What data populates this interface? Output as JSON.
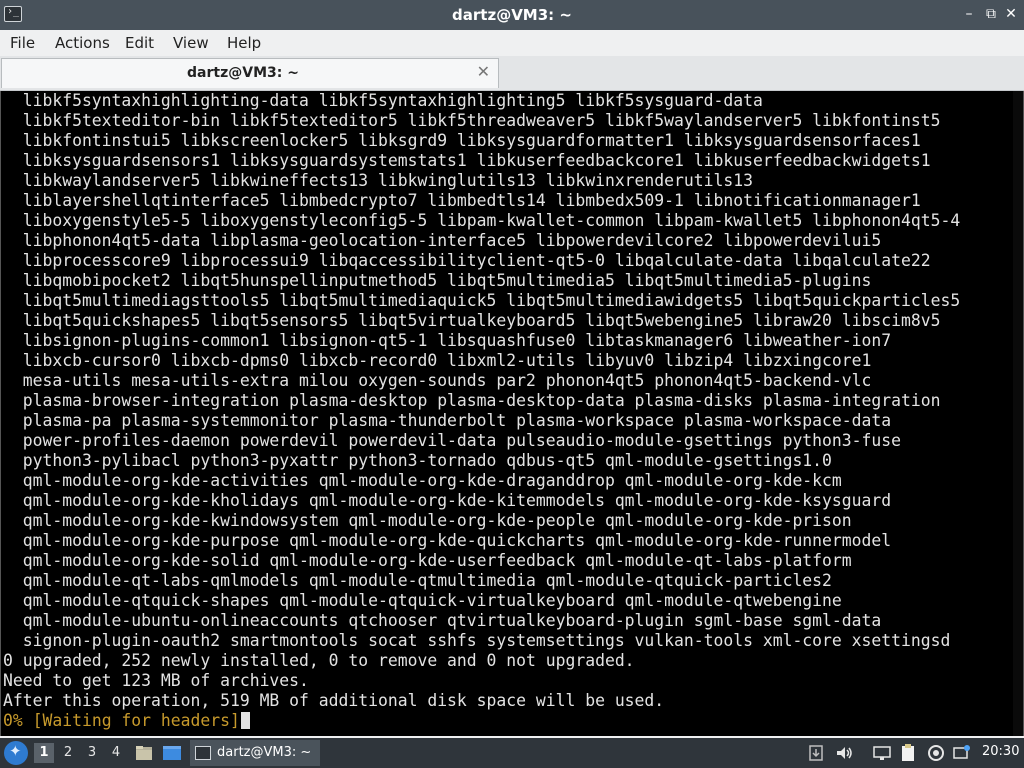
{
  "window": {
    "title": "dartz@VM3: ~",
    "controls": {
      "minimize": "–",
      "maximize": "⧉",
      "close": "✕"
    }
  },
  "menu": {
    "items": [
      "File",
      "Actions",
      "Edit",
      "View",
      "Help"
    ]
  },
  "tab": {
    "label": "dartz@VM3: ~",
    "close": "✕"
  },
  "terminal": {
    "lines": [
      "  libkf5syntaxhighlighting-data libkf5syntaxhighlighting5 libkf5sysguard-data",
      "  libkf5texteditor-bin libkf5texteditor5 libkf5threadweaver5 libkf5waylandserver5 libkfontinst5",
      "  libkfontinstui5 libkscreenlocker5 libksgrd9 libksysguardformatter1 libksysguardsensorfaces1",
      "  libksysguardsensors1 libksysguardsystemstats1 libkuserfeedbackcore1 libkuserfeedbackwidgets1",
      "  libkwaylandserver5 libkwineffects13 libkwinglutils13 libkwinxrenderutils13",
      "  liblayershellqtinterface5 libmbedcrypto7 libmbedtls14 libmbedx509-1 libnotificationmanager1",
      "  liboxygenstyle5-5 liboxygenstyleconfig5-5 libpam-kwallet-common libpam-kwallet5 libphonon4qt5-4",
      "  libphonon4qt5-data libplasma-geolocation-interface5 libpowerdevilcore2 libpowerdevilui5",
      "  libprocesscore9 libprocessui9 libqaccessibilityclient-qt5-0 libqalculate-data libqalculate22",
      "  libqmobipocket2 libqt5hunspellinputmethod5 libqt5multimedia5 libqt5multimedia5-plugins",
      "  libqt5multimediagsttools5 libqt5multimediaquick5 libqt5multimediawidgets5 libqt5quickparticles5",
      "  libqt5quickshapes5 libqt5sensors5 libqt5virtualkeyboard5 libqt5webengine5 libraw20 libscim8v5",
      "  libsignon-plugins-common1 libsignon-qt5-1 libsquashfuse0 libtaskmanager6 libweather-ion7",
      "  libxcb-cursor0 libxcb-dpms0 libxcb-record0 libxml2-utils libyuv0 libzip4 libzxingcore1",
      "  mesa-utils mesa-utils-extra milou oxygen-sounds par2 phonon4qt5 phonon4qt5-backend-vlc",
      "  plasma-browser-integration plasma-desktop plasma-desktop-data plasma-disks plasma-integration",
      "  plasma-pa plasma-systemmonitor plasma-thunderbolt plasma-workspace plasma-workspace-data",
      "  power-profiles-daemon powerdevil powerdevil-data pulseaudio-module-gsettings python3-fuse",
      "  python3-pylibacl python3-pyxattr python3-tornado qdbus-qt5 qml-module-gsettings1.0",
      "  qml-module-org-kde-activities qml-module-org-kde-draganddrop qml-module-org-kde-kcm",
      "  qml-module-org-kde-kholidays qml-module-org-kde-kitemmodels qml-module-org-kde-ksysguard",
      "  qml-module-org-kde-kwindowsystem qml-module-org-kde-people qml-module-org-kde-prison",
      "  qml-module-org-kde-purpose qml-module-org-kde-quickcharts qml-module-org-kde-runnermodel",
      "  qml-module-org-kde-solid qml-module-org-kde-userfeedback qml-module-qt-labs-platform",
      "  qml-module-qt-labs-qmlmodels qml-module-qtmultimedia qml-module-qtquick-particles2",
      "  qml-module-qtquick-shapes qml-module-qtquick-virtualkeyboard qml-module-qtwebengine",
      "  qml-module-ubuntu-onlineaccounts qtchooser qtvirtualkeyboard-plugin sgml-base sgml-data",
      "  signon-plugin-oauth2 smartmontools socat sshfs systemsettings vulkan-tools xml-core xsettingsd",
      "0 upgraded, 252 newly installed, 0 to remove and 0 not upgraded.",
      "Need to get 123 MB of archives.",
      "After this operation, 519 MB of additional disk space will be used."
    ],
    "progress_percent": "0%",
    "progress_status": "[Waiting for headers]"
  },
  "taskbar": {
    "workspaces": [
      "1",
      "2",
      "3",
      "4"
    ],
    "active_workspace": "1",
    "task_label": "dartz@VM3: ~",
    "clock": "20:30"
  }
}
